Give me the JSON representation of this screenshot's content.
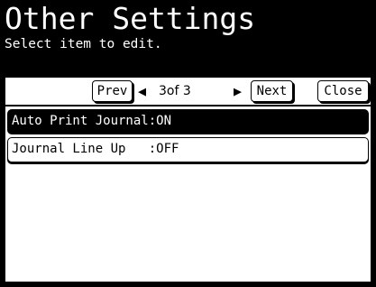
{
  "header": {
    "title": "Other Settings",
    "subtitle": "Select item to edit."
  },
  "nav": {
    "prev_label": "Prev",
    "prev_arrow": "◀",
    "page_indicator": "3of  3",
    "next_arrow": "▶",
    "next_label": "Next",
    "close_label": "Close"
  },
  "items": [
    {
      "label": "Auto Print Journal:ON",
      "selected": true
    },
    {
      "label": "Journal Line Up   :OFF",
      "selected": false
    }
  ]
}
